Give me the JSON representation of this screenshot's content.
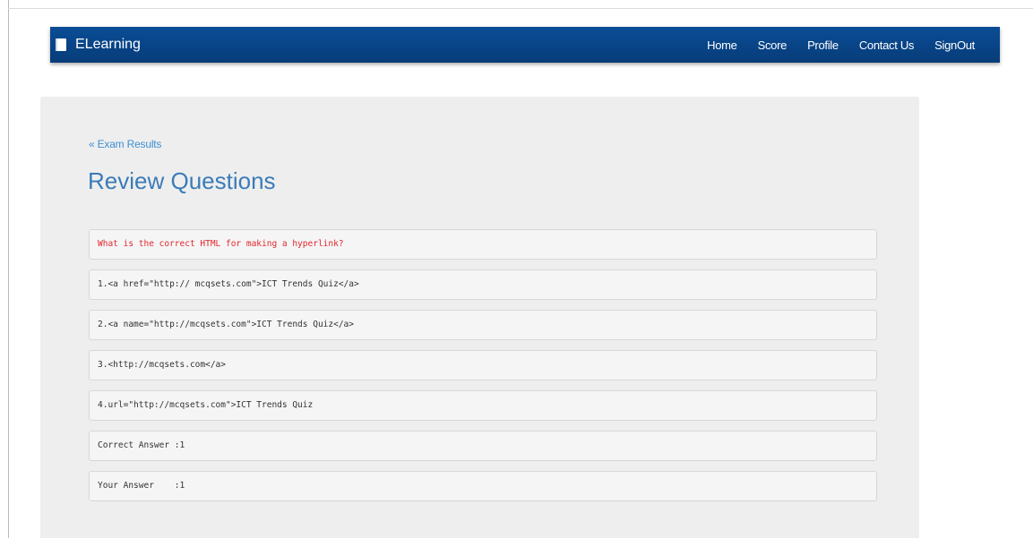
{
  "navbar": {
    "brand": "ELearning",
    "brand_icon": "book-icon",
    "background_color": "#0a4d96",
    "links": [
      "Home",
      "Score",
      "Profile",
      "Contact Us",
      "SignOut"
    ]
  },
  "main": {
    "back_link": "« Exam Results",
    "title": "Review Questions",
    "question": "What is the correct HTML for making a hyperlink?",
    "options": [
      "1.<a href=\"http:// mcqsets.com\">ICT Trends Quiz</a>",
      "2.<a name=\"http://mcqsets.com\">ICT Trends Quiz</a>",
      "3.<http://mcqsets.com</a>",
      "4.url=\"http://mcqsets.com\">ICT Trends Quiz"
    ],
    "correct_answer": "Correct Answer :1",
    "your_answer": "Your Answer    :1",
    "question_color": "#e3262d",
    "title_color": "#3b7bb8",
    "link_color": "#3d8fd4"
  }
}
